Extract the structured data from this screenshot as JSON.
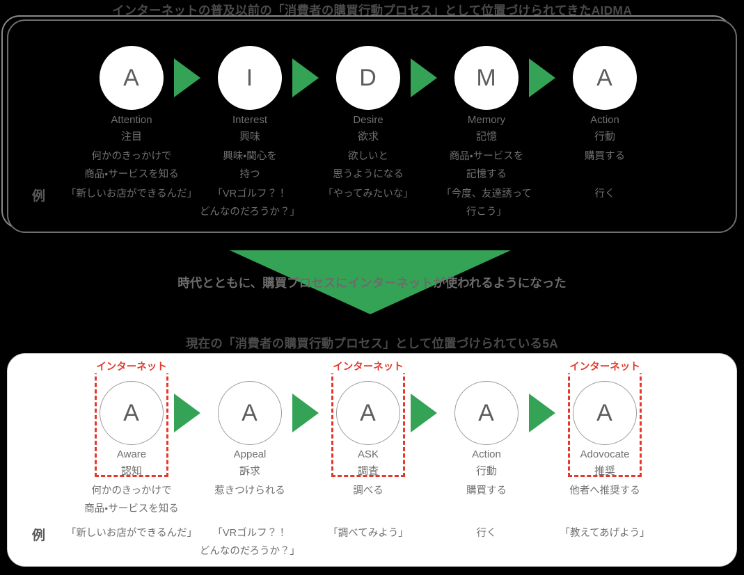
{
  "titles": {
    "aidma": "インターネットの普及以前の「消費者の購買行動プロセス」として位置づけられてきたAIDMA",
    "five_a": "現在の「消費者の購買行動プロセス」として位置づけられている5A"
  },
  "middle": {
    "caption": "時代とともに、購買プロセスにインターネットが使われるようになった",
    "arrow_icon": "down-triangle-icon"
  },
  "labels": {
    "example_marker": "例",
    "internet_tag": "インターネット"
  },
  "colors": {
    "green": "#35a356",
    "red": "#e2392c",
    "text_gray": "#6f6f6f",
    "panel_black": "#000000",
    "panel_white": "#ffffff"
  },
  "aidma": {
    "stages": [
      {
        "letter": "A",
        "en": "Attention",
        "jp": "注目",
        "desc": "何かのきっかけで\n商品・サービスを知る",
        "desc_line1": "何かのきっかけで",
        "desc_line2": "商品・サービスを知る",
        "example_line1": "「新しいお店ができるんだ」",
        "example_line2": ""
      },
      {
        "letter": "I",
        "en": "Interest",
        "jp": "興味",
        "desc_line1": "興味・関心を",
        "desc_line2": "持つ",
        "example_line1": "「VRゴルフ？！",
        "example_line2": "どんなのだろうか？」"
      },
      {
        "letter": "D",
        "en": "Desire",
        "jp": "欲求",
        "desc_line1": "欲しいと",
        "desc_line2": "思うようになる",
        "example_line1": "「やってみたいな」",
        "example_line2": ""
      },
      {
        "letter": "M",
        "en": "Memory",
        "jp": "記憶",
        "desc_line1": "商品・サービスを",
        "desc_line2": "記憶する",
        "example_line1": "「今度、友達誘って",
        "example_line2": "行こう」"
      },
      {
        "letter": "A",
        "en": "Action",
        "jp": "行動",
        "desc_line1": "購買する",
        "desc_line2": "",
        "example_line1": "行く",
        "example_line2": ""
      }
    ]
  },
  "five_a": {
    "stages": [
      {
        "letter": "A",
        "en": "Aware",
        "jp": "認知",
        "internet": true,
        "desc_line1": "何かのきっかけで",
        "desc_line2": "商品・サービスを知る",
        "example_line1": "「新しいお店ができるんだ」",
        "example_line2": ""
      },
      {
        "letter": "A",
        "en": "Appeal",
        "jp": "訴求",
        "internet": false,
        "desc_line1": "惹きつけられる",
        "desc_line2": "",
        "example_line1": "「VRゴルフ？！",
        "example_line2": "どんなのだろうか？」"
      },
      {
        "letter": "A",
        "en": "ASK",
        "jp": "調査",
        "internet": true,
        "desc_line1": "調べる",
        "desc_line2": "",
        "example_line1": "「調べてみよう」",
        "example_line2": ""
      },
      {
        "letter": "A",
        "en": "Action",
        "jp": "行動",
        "internet": false,
        "desc_line1": "購買する",
        "desc_line2": "",
        "example_line1": "行く",
        "example_line2": ""
      },
      {
        "letter": "A",
        "en": "Adovocate",
        "jp": "推奨",
        "internet": true,
        "desc_line1": "他者へ推奨する",
        "desc_line2": "",
        "example_line1": "「教えてあげよう」",
        "example_line2": ""
      }
    ]
  }
}
